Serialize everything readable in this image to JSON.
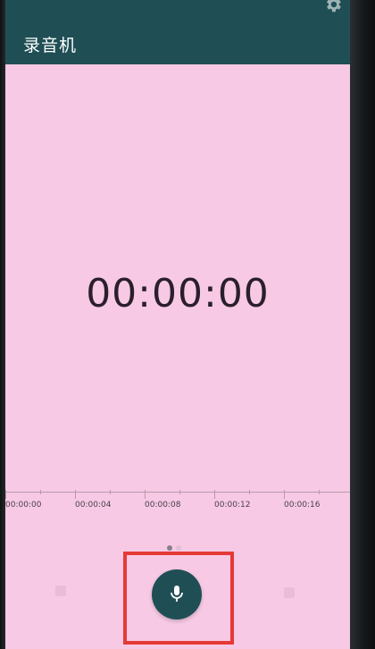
{
  "app": {
    "title": "录音机",
    "accent_color": "#1f4f55",
    "background_color": "#f7c9e4"
  },
  "icons": {
    "settings": "gear-icon",
    "record": "microphone-icon"
  },
  "timer": {
    "elapsed": "00:00:00"
  },
  "timeline": {
    "labels": [
      "00:00:00",
      "00:00:04",
      "00:00:08",
      "00:00:12",
      "00:00:16"
    ]
  },
  "pager": {
    "pages": 2,
    "active_index": 0
  }
}
